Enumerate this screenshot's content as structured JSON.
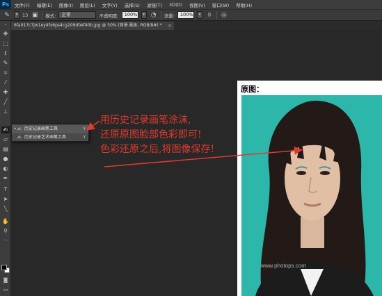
{
  "app": {
    "logo": "Ps"
  },
  "menu": [
    "文件(F)",
    "编辑(E)",
    "图像(I)",
    "图层(L)",
    "文字(Y)",
    "选择(S)",
    "滤镜(T)",
    "3D(D)",
    "视图(V)",
    "窗口(W)",
    "帮助(H)"
  ],
  "options": {
    "brush_size": "13",
    "mode_label": "模式:",
    "mode_value": "正常",
    "opacity_label": "不透明度:",
    "opacity_value": "100%",
    "flow_label": "流量:",
    "flow_value": "100%"
  },
  "document_tab": {
    "title": "6fa017c7jw1ey4fx6ps4cg209d0ef40b.jpg @ 50% (背景 副本, RGB/8#) *",
    "close": "×"
  },
  "flyout": {
    "items": [
      {
        "label": "历史记录画笔工具",
        "shortcut": "Y",
        "selected": true
      },
      {
        "label": "历史记录艺术画笔工具",
        "shortcut": "Y",
        "selected": false
      }
    ]
  },
  "canvas": {
    "image_title": "原图：",
    "watermark": "www.photops.com"
  },
  "annotation": {
    "lines": [
      "用历史记录画笔涂沫,",
      "还原原图脸部色彩即可!",
      "色彩还原之后,将图像保存!"
    ],
    "color": "#e03a30"
  },
  "colors": {
    "photo_background": "#2db7aa",
    "menu_bar": "#3c3c3c",
    "workspace": "#282828"
  }
}
